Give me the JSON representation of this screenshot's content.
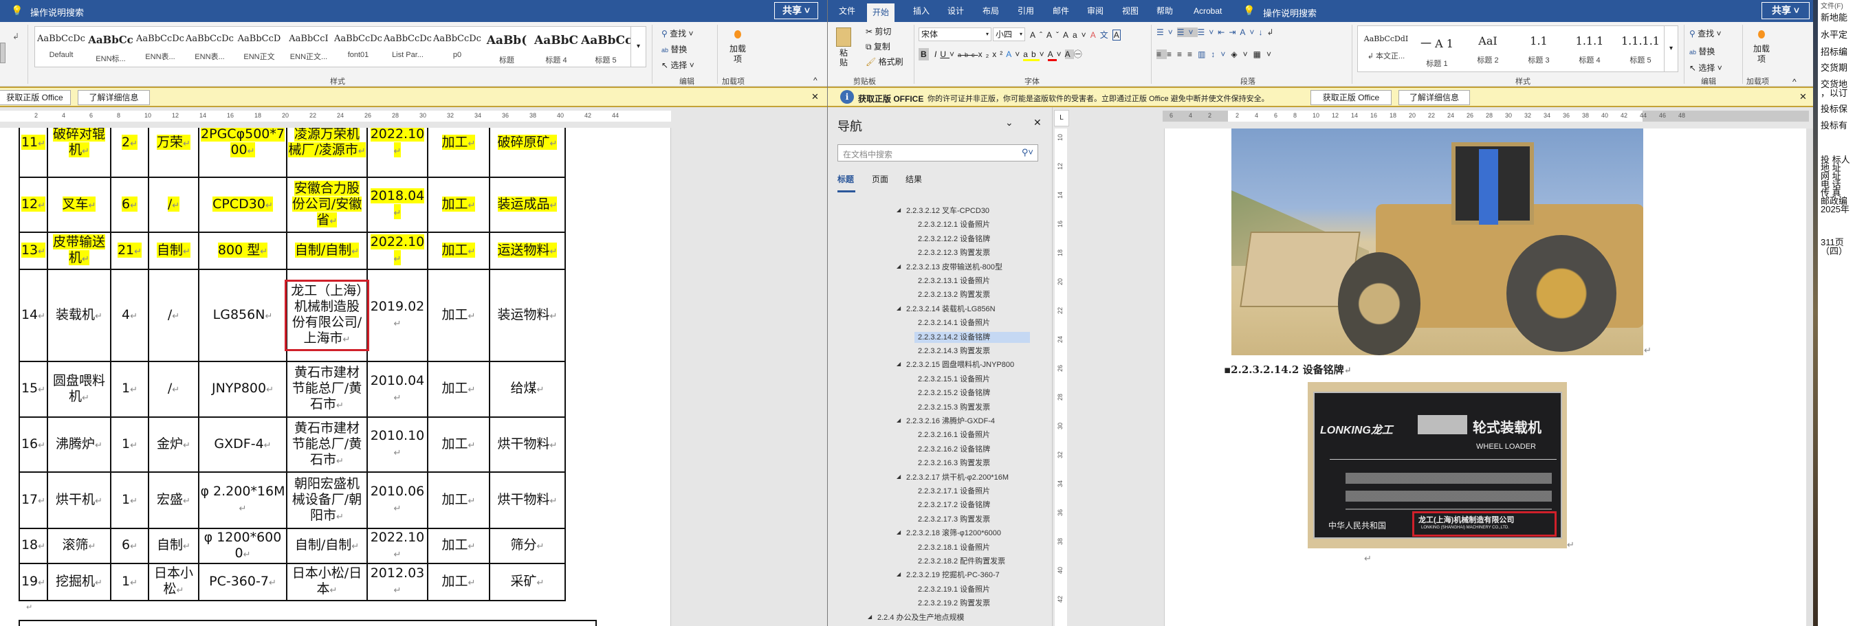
{
  "left_window": {
    "search_label": "操作说明搜索",
    "share_label": "共享",
    "styles": [
      {
        "preview": "AaBbCcDc",
        "name": "Default"
      },
      {
        "preview": "AaBbCc",
        "name": "ENN标..."
      },
      {
        "preview": "AaBbCcDc",
        "name": "ENN表..."
      },
      {
        "preview": "AaBbCcDc",
        "name": "ENN表..."
      },
      {
        "preview": "AaBbCcD",
        "name": "ENN正文"
      },
      {
        "preview": "AaBbCcI",
        "name": "ENN正文..."
      },
      {
        "preview": "AaBbCcDc",
        "name": "font01"
      },
      {
        "preview": "AaBbCcDc",
        "name": "List Par..."
      },
      {
        "preview": "AaBbCcDc",
        "name": "p0"
      },
      {
        "preview": "AaBb(",
        "name": "标题"
      },
      {
        "preview": "AaBbC",
        "name": "标题 4"
      },
      {
        "preview": "AaBbCc",
        "name": "标题 5"
      }
    ],
    "group_styles": "样式",
    "editing": {
      "find": "查找",
      "replace": "替换",
      "select": "选择",
      "label": "编辑"
    },
    "addins": {
      "button": "加载项",
      "label": "加载项"
    },
    "infobar": {
      "get_genuine": "获取正版 Office",
      "learn_more": "了解详细信息"
    },
    "ruler_labels": [
      "2",
      "4",
      "6",
      "8",
      "10",
      "12",
      "14",
      "16",
      "18",
      "20",
      "22",
      "24",
      "26",
      "28",
      "30",
      "32",
      "34",
      "36",
      "38",
      "40",
      "42",
      "44"
    ]
  },
  "table": {
    "rows": [
      {
        "no": "11",
        "name": "破碎对辊机",
        "qty": "2",
        "brand": "万荣",
        "model": "2PGCφ500*700",
        "maker": "凌源万荣机械厂/凌源市",
        "date": "2022.10",
        "nature": "加工",
        "use": "破碎原矿",
        "highlight": true
      },
      {
        "no": "12",
        "name": "叉车",
        "qty": "6",
        "brand": "/",
        "model": "CPCD30",
        "maker": "安徽合力股份公司/安徽省",
        "date": "2018.04",
        "nature": "加工",
        "use": "装运成品",
        "highlight": true
      },
      {
        "no": "13",
        "name": "皮带输送机",
        "qty": "21",
        "brand": "自制",
        "model": "800 型",
        "maker": "自制/自制",
        "date": "2022.10",
        "nature": "加工",
        "use": "运送物料",
        "highlight": true
      },
      {
        "no": "14",
        "name": "装载机",
        "qty": "4",
        "brand": "/",
        "model": "LG856N",
        "maker": "龙工（上海）机械制造股份有限公司/上海市",
        "date": "2019.02",
        "nature": "加工",
        "use": "装运物料",
        "highlight": false,
        "boxed": true
      },
      {
        "no": "15",
        "name": "圆盘喂料机",
        "qty": "1",
        "brand": "/",
        "model": "JNYP800",
        "maker": "黄石市建材节能总厂/黄石市",
        "date": "2010.04",
        "nature": "加工",
        "use": "给煤",
        "highlight": false
      },
      {
        "no": "16",
        "name": "沸腾炉",
        "qty": "1",
        "brand": "金炉",
        "model": "GXDF-4",
        "maker": "黄石市建材节能总厂/黄石市",
        "date": "2010.10",
        "nature": "加工",
        "use": "烘干物料",
        "highlight": false
      },
      {
        "no": "17",
        "name": "烘干机",
        "qty": "1",
        "brand": "宏盛",
        "model": "φ 2.200*16M",
        "maker": "朝阳宏盛机械设备厂/朝阳市",
        "date": "2010.06",
        "nature": "加工",
        "use": "烘干物料",
        "highlight": false
      },
      {
        "no": "18",
        "name": "滚筛",
        "qty": "6",
        "brand": "自制",
        "model": "φ 1200*6000",
        "maker": "自制/自制",
        "date": "2022.10",
        "nature": "加工",
        "use": "筛分",
        "highlight": false
      },
      {
        "no": "19",
        "name": "挖掘机",
        "qty": "1",
        "brand": "日本小松",
        "model": "PC-360-7",
        "maker": "日本小松/日本",
        "date": "2012.03",
        "nature": "加工",
        "use": "采矿",
        "highlight": false
      }
    ]
  },
  "right_window": {
    "tabs": [
      "文件",
      "开始",
      "插入",
      "设计",
      "布局",
      "引用",
      "邮件",
      "审阅",
      "视图",
      "帮助",
      "Acrobat"
    ],
    "active_tab": "开始",
    "search_label": "操作说明搜索",
    "share_label": "共享",
    "clipboard": {
      "paste": "粘贴",
      "cut": "剪切",
      "copy": "复制",
      "format_painter": "格式刷",
      "label": "剪贴板"
    },
    "font": {
      "name": "宋体",
      "size": "小四",
      "label": "字体"
    },
    "paragraph_label": "段落",
    "styles": [
      {
        "preview": "AaBbCcDdI",
        "name": "↲ 本文正..."
      },
      {
        "preview": "一  A 1",
        "name": "标题 1"
      },
      {
        "preview": "AaI",
        "name": "标题 2"
      },
      {
        "preview": "1.1",
        "name": "标题 3"
      },
      {
        "preview": "1.1.1",
        "name": "标题 4"
      },
      {
        "preview": "1.1.1.1",
        "name": "标题 5"
      }
    ],
    "styles_label": "样式",
    "editing": {
      "find": "查找",
      "replace": "替换",
      "select": "选择",
      "label": "编辑"
    },
    "addins": {
      "button": "加载项",
      "label": "加载项"
    },
    "infobar": {
      "title": "获取正版 OFFICE",
      "message": "你的许可证并非正版，你可能是盗版软件的受害者。立即通过正版 Office 避免中断并使文件保持安全。",
      "get_genuine": "获取正版 Office",
      "learn_more": "了解详细信息"
    },
    "ruler_labels": [
      "6",
      "4",
      "2",
      "2",
      "4",
      "6",
      "8",
      "10",
      "12",
      "14",
      "16",
      "18",
      "20",
      "22",
      "24",
      "26",
      "28",
      "30",
      "32",
      "34",
      "36",
      "38",
      "40",
      "42",
      "44",
      "46",
      "48"
    ],
    "vruler_labels": [
      "10",
      "12",
      "14",
      "16",
      "18",
      "20",
      "22",
      "24",
      "26",
      "28",
      "30",
      "32",
      "34",
      "36",
      "38",
      "40",
      "42"
    ]
  },
  "nav": {
    "title": "导航",
    "search_placeholder": "在文档中搜索",
    "tabs": [
      "标题",
      "页面",
      "结果"
    ],
    "items": [
      {
        "label": "2.2.3.2.12 叉车-CPCD30",
        "level": 1
      },
      {
        "label": "2.2.3.2.12.1 设备照片",
        "level": 2
      },
      {
        "label": "2.2.3.2.12.2 设备铭牌",
        "level": 2
      },
      {
        "label": "2.2.3.2.12.3 购置发票",
        "level": 2
      },
      {
        "label": "2.2.3.2.13 皮带输送机-800型",
        "level": 1
      },
      {
        "label": "2.2.3.2.13.1 设备照片",
        "level": 2
      },
      {
        "label": "2.2.3.2.13.2 购置发票",
        "level": 2
      },
      {
        "label": "2.2.3.2.14 装载机-LG856N",
        "level": 1
      },
      {
        "label": "2.2.3.2.14.1 设备照片",
        "level": 2
      },
      {
        "label": "2.2.3.2.14.2 设备铭牌",
        "level": 2,
        "selected": true
      },
      {
        "label": "2.2.3.2.14.3 购置发票",
        "level": 2
      },
      {
        "label": "2.2.3.2.15 圆盘喂料机-JNYP800",
        "level": 1
      },
      {
        "label": "2.2.3.2.15.1 设备照片",
        "level": 2
      },
      {
        "label": "2.2.3.2.15.2 设备铭牌",
        "level": 2
      },
      {
        "label": "2.2.3.2.15.3 购置发票",
        "level": 2
      },
      {
        "label": "2.2.3.2.16 沸腾炉-GXDF-4",
        "level": 1
      },
      {
        "label": "2.2.3.2.16.1 设备照片",
        "level": 2
      },
      {
        "label": "2.2.3.2.16.2 设备铭牌",
        "level": 2
      },
      {
        "label": "2.2.3.2.16.3 购置发票",
        "level": 2
      },
      {
        "label": "2.2.3.2.17 烘干机-φ2.200*16M",
        "level": 1
      },
      {
        "label": "2.2.3.2.17.1 设备照片",
        "level": 2
      },
      {
        "label": "2.2.3.2.17.2 设备铭牌",
        "level": 2
      },
      {
        "label": "2.2.3.2.17.3 购置发票",
        "level": 2
      },
      {
        "label": "2.2.3.2.18 滚筛-φ1200*6000",
        "level": 1
      },
      {
        "label": "2.2.3.2.18.1 设备照片",
        "level": 2
      },
      {
        "label": "2.2.3.2.18.2 配件购置发票",
        "level": 2
      },
      {
        "label": "2.2.3.2.19 挖掘机-PC-360-7",
        "level": 1
      },
      {
        "label": "2.2.3.2.19.1 设备照片",
        "level": 2
      },
      {
        "label": "2.2.3.2.19.2 购置发票",
        "level": 2
      },
      {
        "label": "2.2.4 办公及生产地点规模",
        "level": 0
      }
    ]
  },
  "document": {
    "heading": "2.2.3.2.14.2  设备铭牌",
    "nameplate": {
      "brand": "LONKING龙工",
      "type_cn": "轮式装载机",
      "type_en": "WHEEL LOADER",
      "maker_cn": "龙工(上海)机械制造有限公司",
      "maker_en": "LONKING (SHANGHAI) MACHINERY CO.,LTD.",
      "country": "中华人民共和国"
    }
  },
  "notepad": {
    "menu": "文件(F)",
    "lines": [
      "新地能",
      "水平定",
      "招标编",
      "交货期",
      "交货地",
      "，以订",
      "投标保",
      "投标有",
      "投  标人",
      "地    址",
      "网    址",
      "电    话",
      "传    真",
      "邮政编",
      "2025年",
      "311页",
      "（四）"
    ]
  },
  "colors": {
    "title_blue": "#2b579a",
    "highlight": "#ffff00",
    "callout_red": "#d0202a",
    "info_yellow": "#fbf4bb"
  }
}
